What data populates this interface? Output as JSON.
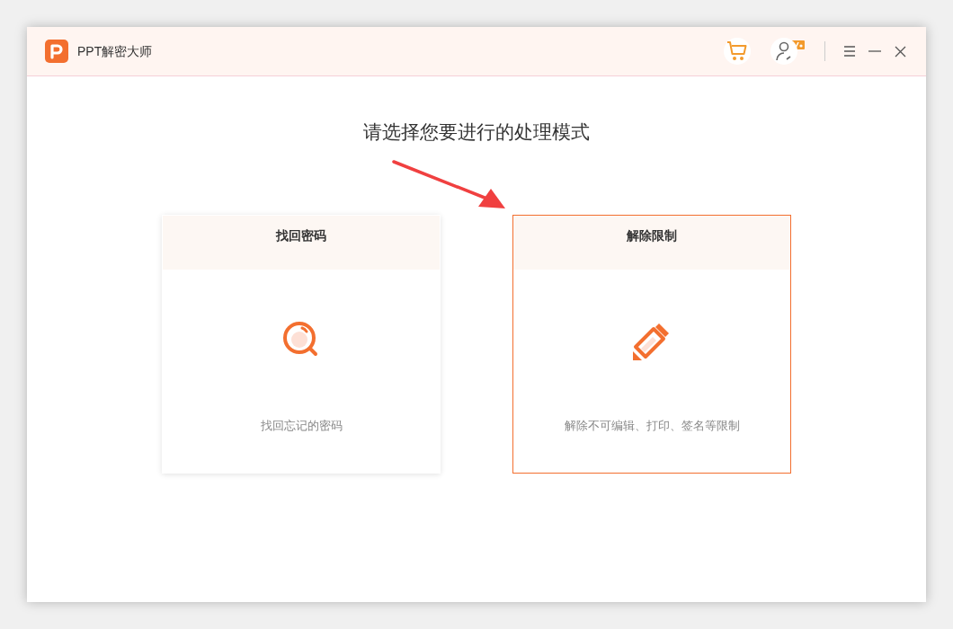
{
  "window": {
    "title": "PPT解密大师"
  },
  "heading": "请选择您要进行的处理模式",
  "cards": [
    {
      "title": "找回密码",
      "description": "找回忘记的密码",
      "kind": "recover",
      "selected": false
    },
    {
      "title": "解除限制",
      "description": "解除不可编辑、打印、签名等限制",
      "kind": "unlock",
      "selected": true
    }
  ]
}
